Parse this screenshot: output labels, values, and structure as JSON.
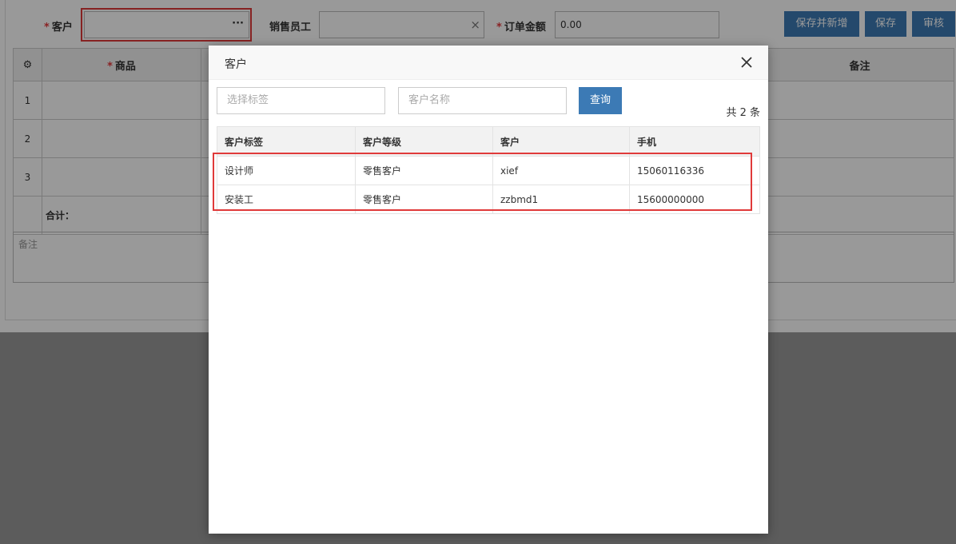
{
  "form": {
    "customer_label": "客户",
    "customer_value": "",
    "customer_more": "···",
    "salesperson_label": "销售员工",
    "salesperson_clear": "×",
    "amount_label": "订单金额",
    "amount_value": "0.00",
    "required_mark": "*",
    "buttons": {
      "save_new": "保存并新增",
      "save": "保存",
      "audit": "审核"
    }
  },
  "grid": {
    "settings_icon": "⚙",
    "columns": [
      "商品",
      "备注"
    ],
    "rows": [
      "1",
      "2",
      "3"
    ],
    "total_label": "合计："
  },
  "remark": {
    "placeholder": "备注"
  },
  "modal": {
    "title": "客户",
    "close": "×",
    "tag_placeholder": "选择标签",
    "name_placeholder": "客户名称",
    "query_button": "查询",
    "total": "共 2 条",
    "columns": [
      "客户标签",
      "客户等级",
      "客户",
      "手机"
    ],
    "rows": [
      {
        "tag": "设计师",
        "level": "零售客户",
        "name": "xief",
        "phone": "15060116336"
      },
      {
        "tag": "安装工",
        "level": "零售客户",
        "name": "zzbmd1",
        "phone": "15600000000"
      }
    ]
  },
  "colors": {
    "accent": "#3c7ab5",
    "highlight": "#e03a3a",
    "required": "#e4393c"
  }
}
